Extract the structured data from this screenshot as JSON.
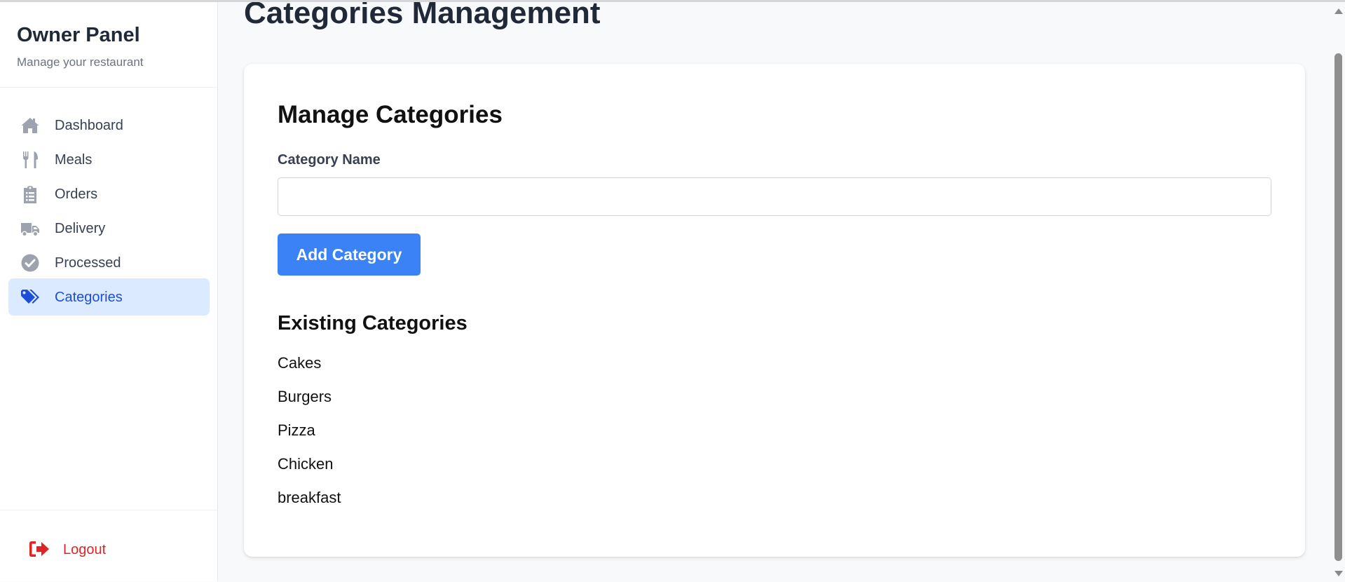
{
  "sidebar": {
    "title": "Owner Panel",
    "subtitle": "Manage your restaurant",
    "items": [
      {
        "label": "Dashboard",
        "icon": "home-icon",
        "active": false
      },
      {
        "label": "Meals",
        "icon": "utensils-icon",
        "active": false
      },
      {
        "label": "Orders",
        "icon": "clipboard-list-icon",
        "active": false
      },
      {
        "label": "Delivery",
        "icon": "truck-icon",
        "active": false
      },
      {
        "label": "Processed",
        "icon": "check-circle-icon",
        "active": false
      },
      {
        "label": "Categories",
        "icon": "tags-icon",
        "active": true
      }
    ],
    "logout_label": "Logout",
    "logout_icon": "sign-out-icon"
  },
  "main": {
    "page_title": "Categories Management",
    "card_title": "Manage Categories",
    "field_label": "Category Name",
    "field_value": "",
    "field_placeholder": "",
    "add_button_label": "Add Category",
    "existing_title": "Existing Categories",
    "categories": [
      "Cakes",
      "Burgers",
      "Pizza",
      "Chicken",
      "breakfast"
    ]
  },
  "colors": {
    "accent": "#3b82f6",
    "active_bg": "#dbeafe",
    "active_text": "#1d4ed8",
    "icon_gray": "#9ca3af",
    "logout_red": "#dc2626"
  }
}
